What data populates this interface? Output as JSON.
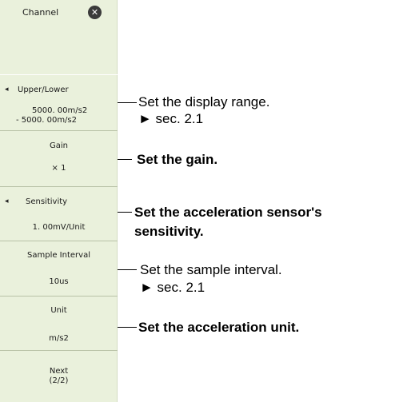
{
  "panel": {
    "channel_label": "Channel",
    "close_icon": "close-icon",
    "upper_lower_label": "Upper/Lower",
    "upper_value": "5000. 00m/s2",
    "lower_value": "-   5000. 00m/s2",
    "gain_label": "Gain",
    "gain_value": "× 1",
    "sensitivity_label": "Sensitivity",
    "sensitivity_value": "1. 00mV/Unit",
    "sample_interval_label": "Sample Interval",
    "sample_interval_value": "10us",
    "unit_label": "Unit",
    "unit_value": "m/s2",
    "next_label": "Next",
    "next_page": "(2/2)",
    "arrow_glyph": "◂"
  },
  "annotations": {
    "display_range": "Set the display range.",
    "display_range_ref": "► sec. 2.1",
    "gain": "Set the gain.",
    "sensitivity_line1": "Set the acceleration sensor's",
    "sensitivity_line2": "sensitivity.",
    "sample_interval": "Set the sample interval.",
    "sample_interval_ref": "► sec. 2.1",
    "unit": "Set the acceleration unit."
  }
}
